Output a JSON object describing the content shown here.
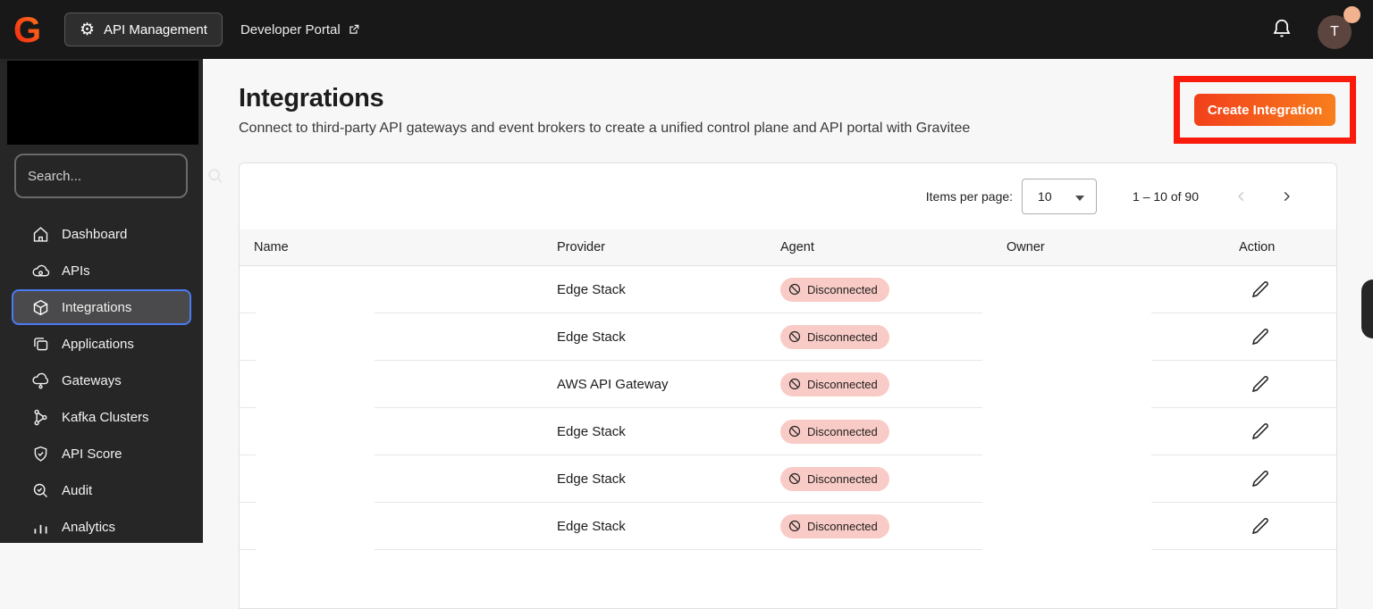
{
  "topbar": {
    "logo_letter": "G",
    "app_switcher_label": "API Management",
    "developer_portal_label": "Developer Portal",
    "avatar_letter": "T"
  },
  "sidebar": {
    "search_placeholder": "Search...",
    "items": [
      {
        "label": "Dashboard",
        "icon": "home-icon",
        "selected": false
      },
      {
        "label": "APIs",
        "icon": "cloud-api-icon",
        "selected": false
      },
      {
        "label": "Integrations",
        "icon": "cube-icon",
        "selected": true
      },
      {
        "label": "Applications",
        "icon": "layered-squares-icon",
        "selected": false
      },
      {
        "label": "Gateways",
        "icon": "cloud-node-icon",
        "selected": false
      },
      {
        "label": "Kafka Clusters",
        "icon": "kafka-nodes-icon",
        "selected": false
      },
      {
        "label": "API Score",
        "icon": "shield-check-icon",
        "selected": false
      },
      {
        "label": "Audit",
        "icon": "search-check-icon",
        "selected": false
      },
      {
        "label": "Analytics",
        "icon": "bar-chart-icon",
        "selected": false
      }
    ]
  },
  "main": {
    "title": "Integrations",
    "subtitle": "Connect to third-party API gateways and event brokers to create a unified control plane and API portal with Gravitee",
    "create_button_label": "Create Integration",
    "pagination": {
      "items_per_page_label": "Items per page:",
      "items_per_page_value": "10",
      "range_label": "1 – 10 of 90"
    },
    "table": {
      "columns": [
        "Name",
        "Provider",
        "Agent",
        "Owner",
        "Action"
      ],
      "rows": [
        {
          "name": "",
          "provider": "Edge Stack",
          "agent": "Disconnected",
          "owner": ""
        },
        {
          "name": "",
          "provider": "Edge Stack",
          "agent": "Disconnected",
          "owner": ""
        },
        {
          "name": "",
          "provider": "AWS API Gateway",
          "agent": "Disconnected",
          "owner": ""
        },
        {
          "name": "",
          "provider": "Edge Stack",
          "agent": "Disconnected",
          "owner": ""
        },
        {
          "name": "",
          "provider": "Edge Stack",
          "agent": "Disconnected",
          "owner": ""
        },
        {
          "name": "",
          "provider": "Edge Stack",
          "agent": "Disconnected",
          "owner": ""
        }
      ]
    }
  },
  "colors": {
    "topbar_bg": "#181818",
    "sidebar_bg": "#262626",
    "accent_gradient_start": "#f23e1b",
    "accent_gradient_end": "#f8801d",
    "annotation_red": "#f91c0d",
    "badge_bg": "#f9cbc6",
    "selected_nav_border": "#4c7af1",
    "avatar_bg": "#5c453e",
    "presence_dot": "#f3b28f"
  }
}
